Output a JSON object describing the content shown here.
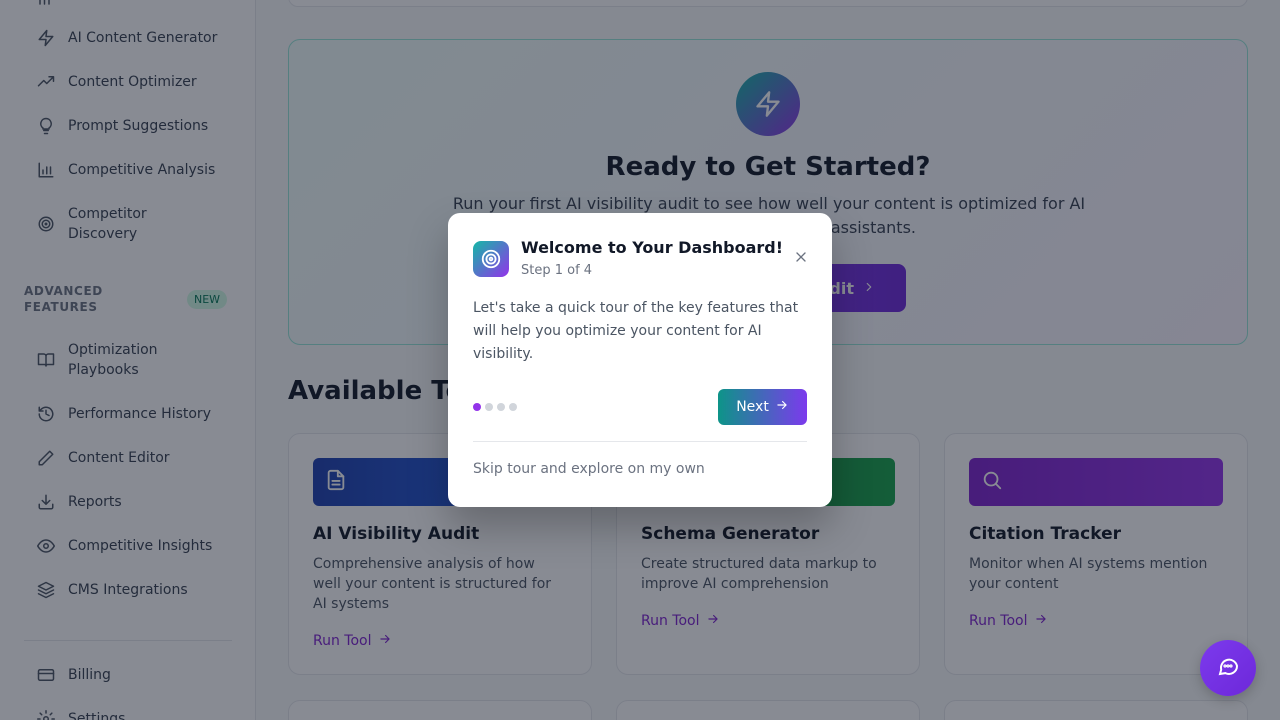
{
  "sidebar": {
    "items": [
      {
        "label": "AI Content Generator",
        "icon": "zap-icon"
      },
      {
        "label": "Content Optimizer",
        "icon": "trending-up-icon"
      },
      {
        "label": "Prompt Suggestions",
        "icon": "lightbulb-icon"
      },
      {
        "label": "Competitive Analysis",
        "icon": "bar-chart-icon"
      },
      {
        "label": "Competitor Discovery",
        "icon": "radar-icon"
      }
    ],
    "section_label": "ADVANCED FEATURES",
    "section_badge": "NEW",
    "advanced_items": [
      {
        "label": "Optimization Playbooks",
        "icon": "book-icon"
      },
      {
        "label": "Performance History",
        "icon": "history-icon"
      },
      {
        "label": "Content Editor",
        "icon": "pencil-icon"
      },
      {
        "label": "Reports",
        "icon": "download-icon"
      },
      {
        "label": "Competitive Insights",
        "icon": "eye-icon"
      },
      {
        "label": "CMS Integrations",
        "icon": "layers-icon"
      }
    ],
    "footer_items": [
      {
        "label": "Billing",
        "icon": "credit-card-icon"
      },
      {
        "label": "Settings",
        "icon": "gear-icon"
      }
    ]
  },
  "hero": {
    "title": "Ready to Get Started?",
    "description": "Run your first AI visibility audit to see how well your content is optimized for AI search engines and voice assistants.",
    "button_label": "Run Audit"
  },
  "tools": {
    "section_title": "Available Tools",
    "cards": [
      {
        "title": "AI Visibility Audit",
        "description": "Comprehensive analysis of how well your content is structured for AI systems",
        "link": "Run Tool",
        "icon": "document-icon",
        "color_from": "#1e40af",
        "color_to": "#2563eb"
      },
      {
        "title": "Schema Generator",
        "description": "Create structured data markup to improve AI comprehension",
        "link": "Run Tool",
        "icon": "code-icon",
        "color_from": "#15803d",
        "color_to": "#16a34a"
      },
      {
        "title": "Citation Tracker",
        "description": "Monitor when AI systems mention your content",
        "link": "Run Tool",
        "icon": "search-icon",
        "color_from": "#7e22ce",
        "color_to": "#9333ea"
      }
    ]
  },
  "modal": {
    "title": "Welcome to Your Dashboard!",
    "step": "Step 1 of 4",
    "body": "Let's take a quick tour of the key features that will help you optimize your content for AI visibility.",
    "steps_total": 4,
    "current_step": 1,
    "next_label": "Next",
    "skip_label": "Skip tour and explore on my own"
  },
  "colors": {
    "accent_teal": "#14b8a6",
    "accent_purple": "#9333ea"
  }
}
